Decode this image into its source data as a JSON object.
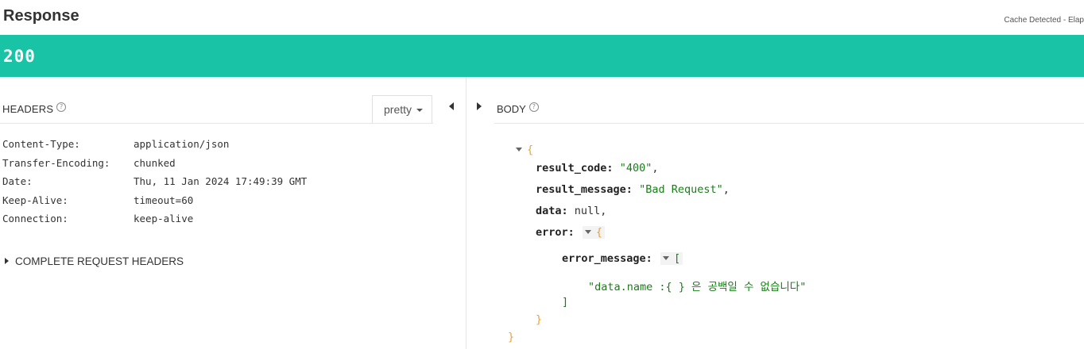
{
  "title": "Response",
  "cache_note": "Cache Detected - Elap",
  "status": {
    "code": "200",
    "color": "#19c4a6"
  },
  "headers_panel": {
    "heading": "HEADERS",
    "help_icon": "question-circle-icon",
    "format_select": {
      "value": "pretty"
    },
    "rows": [
      {
        "key": "Content-Type:",
        "value": "application/json"
      },
      {
        "key": "Transfer-Encoding:",
        "value": "chunked"
      },
      {
        "key": "Date:",
        "value": "Thu, 11 Jan 2024 17:49:39 GMT"
      },
      {
        "key": "Keep-Alive:",
        "value": "timeout=60"
      },
      {
        "key": "Connection:",
        "value": "keep-alive"
      }
    ],
    "complete_request_headers": "COMPLETE REQUEST HEADERS"
  },
  "body_panel": {
    "heading": "BODY",
    "help_icon": "question-circle-icon",
    "json": {
      "open_brace": "{",
      "result_code_key": "result_code:",
      "result_code_value": "\"400\"",
      "result_message_key": "result_message:",
      "result_message_value": "\"Bad Request\"",
      "data_key": "data:",
      "data_value": "null",
      "error_key": "error:",
      "error_open": "{",
      "error_message_key": "error_message:",
      "error_message_open": "[",
      "error_message_item": "\"data.name :{  } 은 공백일 수 없습니다\"",
      "error_message_close": "]",
      "error_close": "}",
      "close_brace": "}",
      "comma": ","
    }
  }
}
